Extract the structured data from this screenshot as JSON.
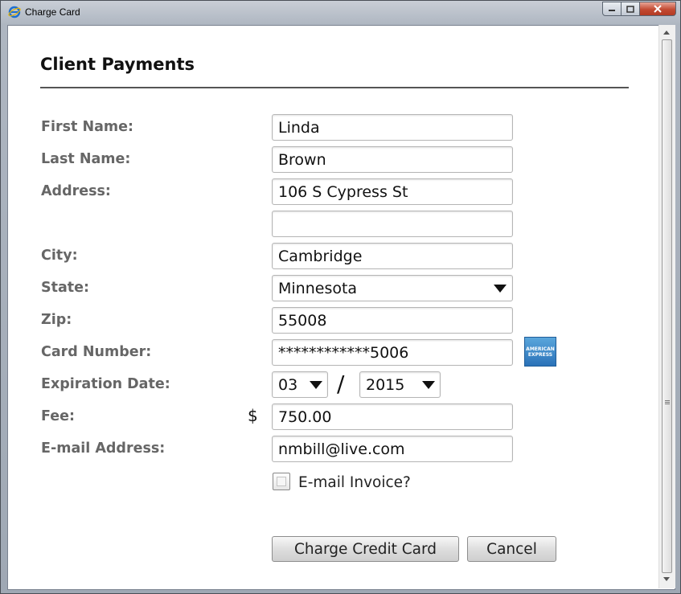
{
  "window": {
    "title": "Charge Card"
  },
  "form": {
    "heading": "Client Payments",
    "fields": {
      "first_name": {
        "label": "First Name:",
        "value": "Linda"
      },
      "last_name": {
        "label": "Last Name:",
        "value": "Brown"
      },
      "address": {
        "label": "Address:",
        "value": "106 S Cypress St",
        "value2": ""
      },
      "city": {
        "label": "City:",
        "value": "Cambridge"
      },
      "state": {
        "label": "State:",
        "value": "Minnesota"
      },
      "zip": {
        "label": "Zip:",
        "value": "55008"
      },
      "card_number": {
        "label": "Card Number:",
        "value": "************5006",
        "card_logo_text": "AMERICAN EXPRESS"
      },
      "expiration": {
        "label": "Expiration Date:",
        "month": "03",
        "year": "2015",
        "separator": "/"
      },
      "fee": {
        "label": "Fee:",
        "currency": "$",
        "value": "750.00"
      },
      "email": {
        "label": "E-mail Address:",
        "value": "nmbill@live.com"
      }
    },
    "email_invoice": {
      "label": "E-mail Invoice?",
      "checked": false
    },
    "buttons": {
      "charge": "Charge Credit Card",
      "cancel": "Cancel"
    }
  }
}
